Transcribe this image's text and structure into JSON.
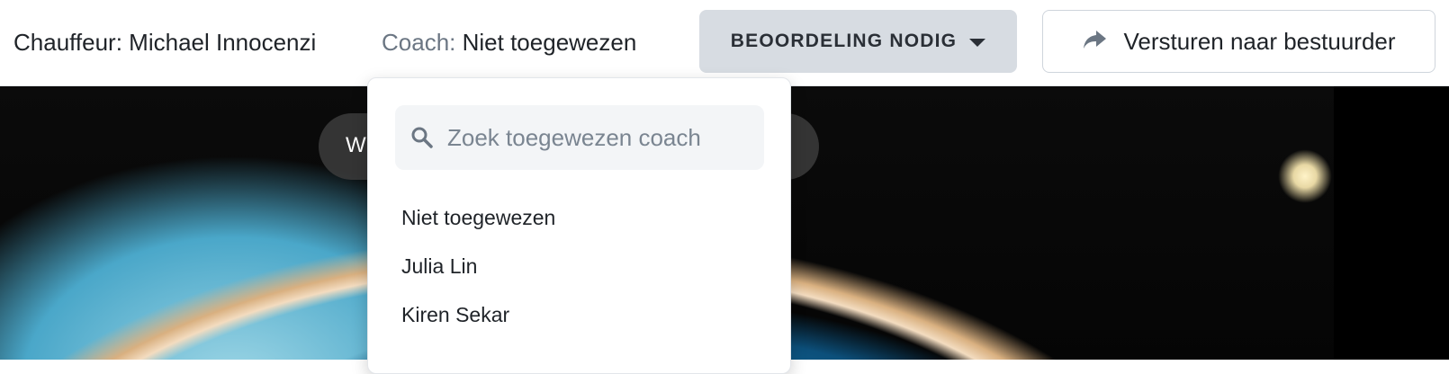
{
  "header": {
    "driver_label": "Chauffeur:",
    "driver_name": "Michael Innocenzi",
    "coach_label": "Coach:",
    "coach_value": "Niet toegewezen",
    "status_button": "BEOORDELING NODIG",
    "send_button": "Versturen naar bestuurder"
  },
  "overlay": {
    "pill_text": "W"
  },
  "coach_dropdown": {
    "search_placeholder": "Zoek toegewezen coach",
    "options": [
      "Niet toegewezen",
      "Julia Lin",
      "Kiren Sekar"
    ]
  },
  "icons": {
    "status_caret": "caret-down-icon",
    "send": "share-arrow-icon",
    "search": "search-icon"
  },
  "colors": {
    "status_button_bg": "#d7dce2",
    "muted_label": "#6b7683"
  }
}
